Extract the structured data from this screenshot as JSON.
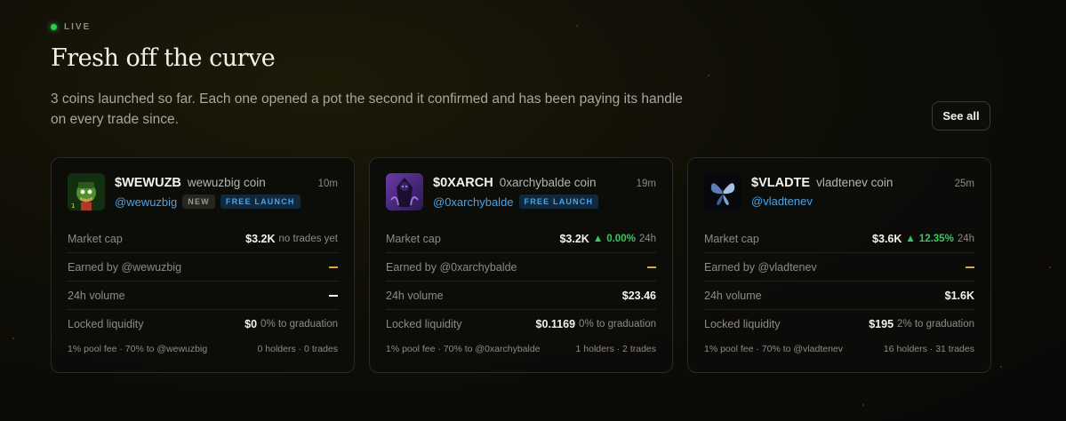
{
  "header": {
    "live_label": "LIVE",
    "title": "Fresh off the curve",
    "description": "3 coins launched so far. Each one opened a pot the second it confirmed and has been paying its handle on every trade since.",
    "see_all_label": "See all"
  },
  "colors": {
    "accent_blue": "#4aa3e8",
    "live_green": "#2ecc55",
    "up_green": "#38c95b",
    "pending_yellow": "#e0a83a"
  },
  "cards": [
    {
      "ticker": "$WEWUZB",
      "name": "wewuzbig coin",
      "age": "10m",
      "handle": "@wewuzbig",
      "badges": [
        "NEW",
        "FREE LAUNCH"
      ],
      "avatar_icon": "cartoon-character-avatar",
      "market_cap_label": "Market cap",
      "market_cap": "$3.2K",
      "market_cap_note": "no trades yet",
      "earned_label": "Earned by @wewuzbig",
      "earned_value": "—",
      "volume_label": "24h volume",
      "volume_value": "—",
      "liquidity_label": "Locked liquidity",
      "liquidity_value": "$0",
      "liquidity_note": "0% to graduation",
      "fee_text": "1% pool fee · 70% to @wewuzbig",
      "holders_text": "0 holders · 0 trades"
    },
    {
      "ticker": "$0XARCH",
      "name": "0xarchybalde coin",
      "age": "19m",
      "handle": "@0xarchybalde",
      "badges": [
        "FREE LAUNCH"
      ],
      "avatar_icon": "purple-figure-avatar",
      "market_cap_label": "Market cap",
      "market_cap": "$3.2K",
      "market_cap_change": "0.00%",
      "market_cap_period": "24h",
      "earned_label": "Earned by @0xarchybalde",
      "earned_value": "—",
      "volume_label": "24h volume",
      "volume_value": "$23.46",
      "liquidity_label": "Locked liquidity",
      "liquidity_value": "$0.1169",
      "liquidity_note": "0% to graduation",
      "fee_text": "1% pool fee · 70% to @0xarchybalde",
      "holders_text": "1 holders · 2 trades"
    },
    {
      "ticker": "$VLADTE",
      "name": "vladtenev coin",
      "age": "25m",
      "handle": "@vladtenev",
      "badges": [],
      "avatar_icon": "blue-butterfly-avatar",
      "market_cap_label": "Market cap",
      "market_cap": "$3.6K",
      "market_cap_change": "12.35%",
      "market_cap_period": "24h",
      "earned_label": "Earned by @vladtenev",
      "earned_value": "—",
      "volume_label": "24h volume",
      "volume_value": "$1.6K",
      "liquidity_label": "Locked liquidity",
      "liquidity_value": "$195",
      "liquidity_note": "2% to graduation",
      "fee_text": "1% pool fee · 70% to @vladtenev",
      "holders_text": "16 holders · 31 trades"
    }
  ]
}
